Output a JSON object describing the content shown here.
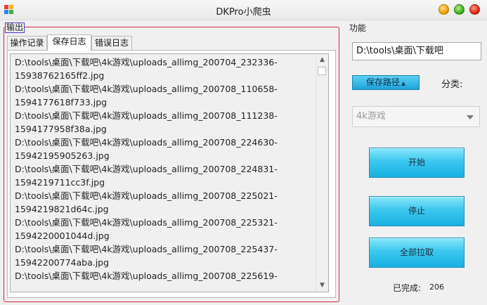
{
  "window": {
    "title": "DKPro小爬虫",
    "icon": "app-grid-icon",
    "controls": [
      "minimize",
      "maximize",
      "close"
    ]
  },
  "output_group": {
    "legend": "输出",
    "tabs": [
      {
        "label": "操作记录",
        "active": false
      },
      {
        "label": "保存日志",
        "active": true
      },
      {
        "label": "错误日志",
        "active": false
      }
    ],
    "log_lines": [
      "D:\\tools\\桌面\\下载吧\\4k游戏\\uploads_allimg_200704_232336-",
      "15938762165ff2.jpg",
      "D:\\tools\\桌面\\下载吧\\4k游戏\\uploads_allimg_200708_110658-",
      "1594177618f733.jpg",
      "D:\\tools\\桌面\\下载吧\\4k游戏\\uploads_allimg_200708_111238-",
      "1594177958f38a.jpg",
      "D:\\tools\\桌面\\下载吧\\4k游戏\\uploads_allimg_200708_224630-",
      "15942195905263.jpg",
      "D:\\tools\\桌面\\下载吧\\4k游戏\\uploads_allimg_200708_224831-",
      "1594219711cc3f.jpg",
      "D:\\tools\\桌面\\下载吧\\4k游戏\\uploads_allimg_200708_225021-",
      "1594219821d64c.jpg",
      "D:\\tools\\桌面\\下载吧\\4k游戏\\uploads_allimg_200708_225321-",
      "1594220001044d.jpg",
      "D:\\tools\\桌面\\下载吧\\4k游戏\\uploads_allimg_200708_225437-",
      "15942200774aba.jpg",
      "D:\\tools\\桌面\\下载吧\\4k游戏\\uploads_allimg_200708_225619-"
    ]
  },
  "function_panel": {
    "legend": "功能",
    "path_value": "D:\\tools\\桌面\\下载吧",
    "save_path_button": "保存路径",
    "category_label": "分类:",
    "category_selected": "4k游戏",
    "start_button": "开始",
    "stop_button": "停止",
    "grab_all_button": "全部拉取",
    "done_label": "已完成:",
    "done_count": "206"
  },
  "colors": {
    "output_border": "#d2283a",
    "button_blue": "#3cc7ef",
    "minimize": "#f0a100",
    "maximize": "#3fae1e",
    "close": "#e02a10"
  }
}
